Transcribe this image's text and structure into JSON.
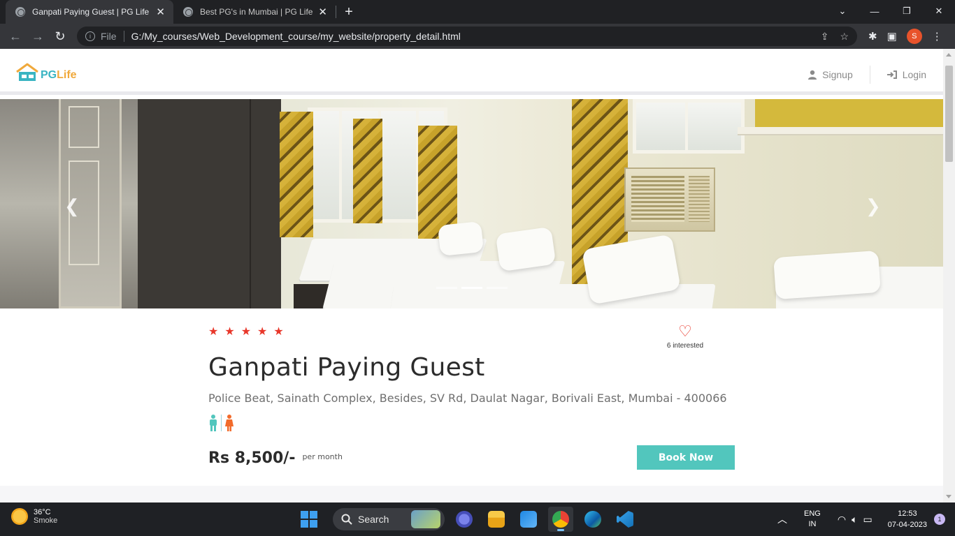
{
  "browser": {
    "tabs": [
      {
        "title": "Ganpati Paying Guest | PG Life",
        "active": true
      },
      {
        "title": "Best PG's in Mumbai | PG Life",
        "active": false
      }
    ],
    "address_scheme": "File",
    "url": "G:/My_courses/Web_Development_course/my_website/property_detail.html",
    "profile_initial": "S"
  },
  "header": {
    "logo_text_pg": "PG",
    "logo_text_life": "Life",
    "nav": [
      {
        "label": "Signup",
        "icon": "user-icon"
      },
      {
        "label": "Login",
        "icon": "sign-in-icon"
      }
    ]
  },
  "carousel": {
    "slide_count": 3,
    "active_index": 1
  },
  "property": {
    "rating": 5,
    "interested_count_text": "6 interested",
    "name": "Ganpati Paying Guest",
    "address": "Police Beat, Sainath Complex, Besides, SV Rd, Daulat Nagar, Borivali East, Mumbai - 400066",
    "gender": [
      "male-icon",
      "female-icon"
    ],
    "price": "Rs 8,500/-",
    "price_unit": "per month",
    "book_label": "Book Now"
  },
  "colors": {
    "accent": "#52c6bd",
    "star": "#e8372a",
    "logo_teal": "#39b4c2",
    "logo_orange": "#f0a93c"
  },
  "taskbar": {
    "weather_temp": "36°C",
    "weather_desc": "Smoke",
    "search_label": "Search",
    "lang_line1": "ENG",
    "lang_line2": "IN",
    "time": "12:53",
    "date": "07-04-2023",
    "notification_count": "1"
  }
}
